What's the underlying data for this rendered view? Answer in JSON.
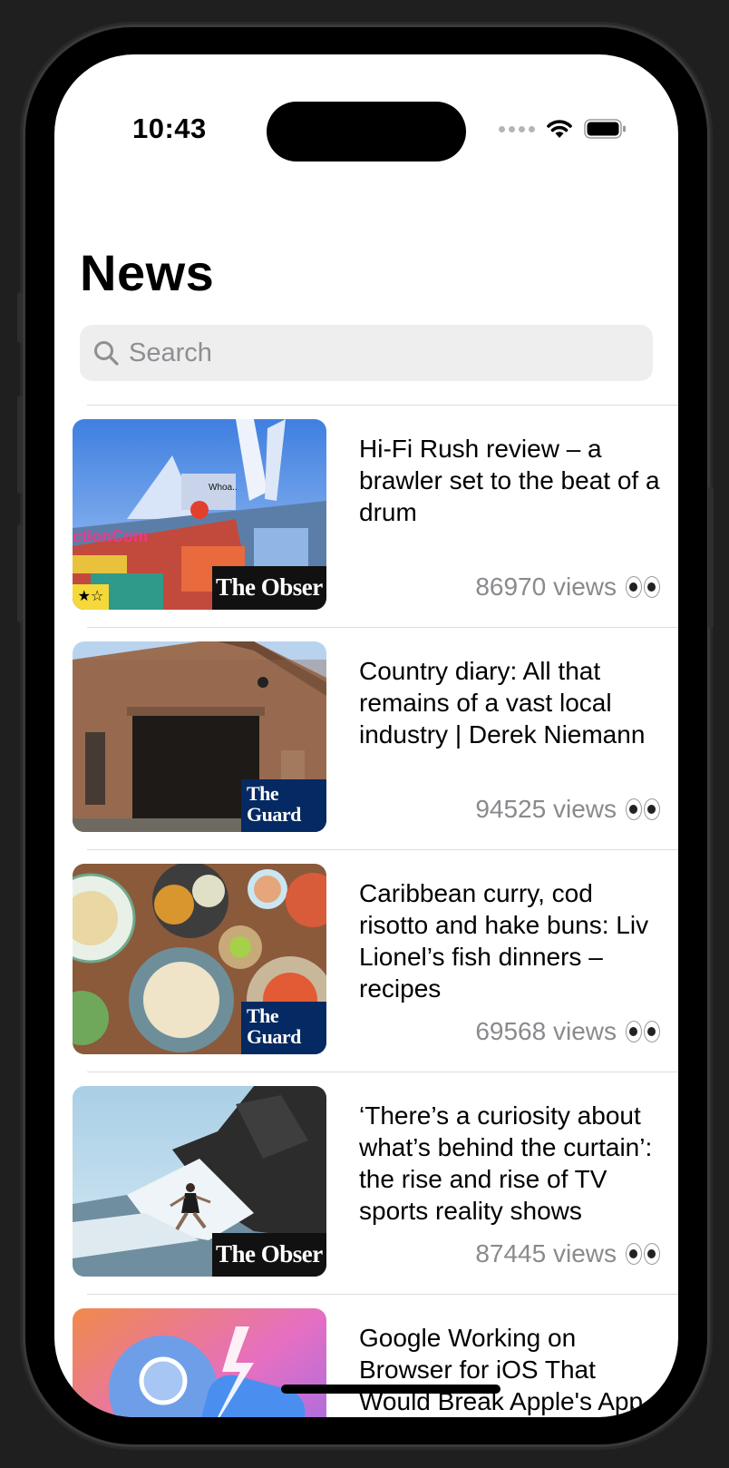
{
  "status_bar": {
    "time": "10:43"
  },
  "nav": {
    "title": "News"
  },
  "search": {
    "placeholder": "Search",
    "value": ""
  },
  "articles": [
    {
      "headline": "Hi-Fi Rush review – a brawler set to the beat of a drum",
      "views": "86970 views",
      "source_badge": "The Obser",
      "rating_badge": "★☆",
      "reaction_icon": "eyes-emoji"
    },
    {
      "headline": "Country diary: All that remains of a vast local industry | Derek Niemann",
      "views": "94525 views",
      "source_badge": "The Guard",
      "reaction_icon": "eyes-emoji"
    },
    {
      "headline": "Caribbean curry, cod risotto and hake buns: Liv Lionel’s fish dinners – recipes",
      "views": "69568 views",
      "source_badge": "The Guard",
      "reaction_icon": "eyes-emoji"
    },
    {
      "headline": "‘There’s a curiosity about what’s behind the curtain’: the rise and rise of TV sports reality shows",
      "views": "87445 views",
      "source_badge": "The Obser",
      "reaction_icon": "eyes-emoji"
    },
    {
      "headline": "Google Working on Browser for iOS That Would Break Apple's App Store Rules",
      "reaction_icon": "eyes-emoji"
    }
  ],
  "colors": {
    "background": "#ffffff",
    "separator": "#dcdcdf",
    "secondary_text": "#8a8a8e",
    "search_fill": "#eeeeef",
    "guardian_blue": "#052962"
  }
}
